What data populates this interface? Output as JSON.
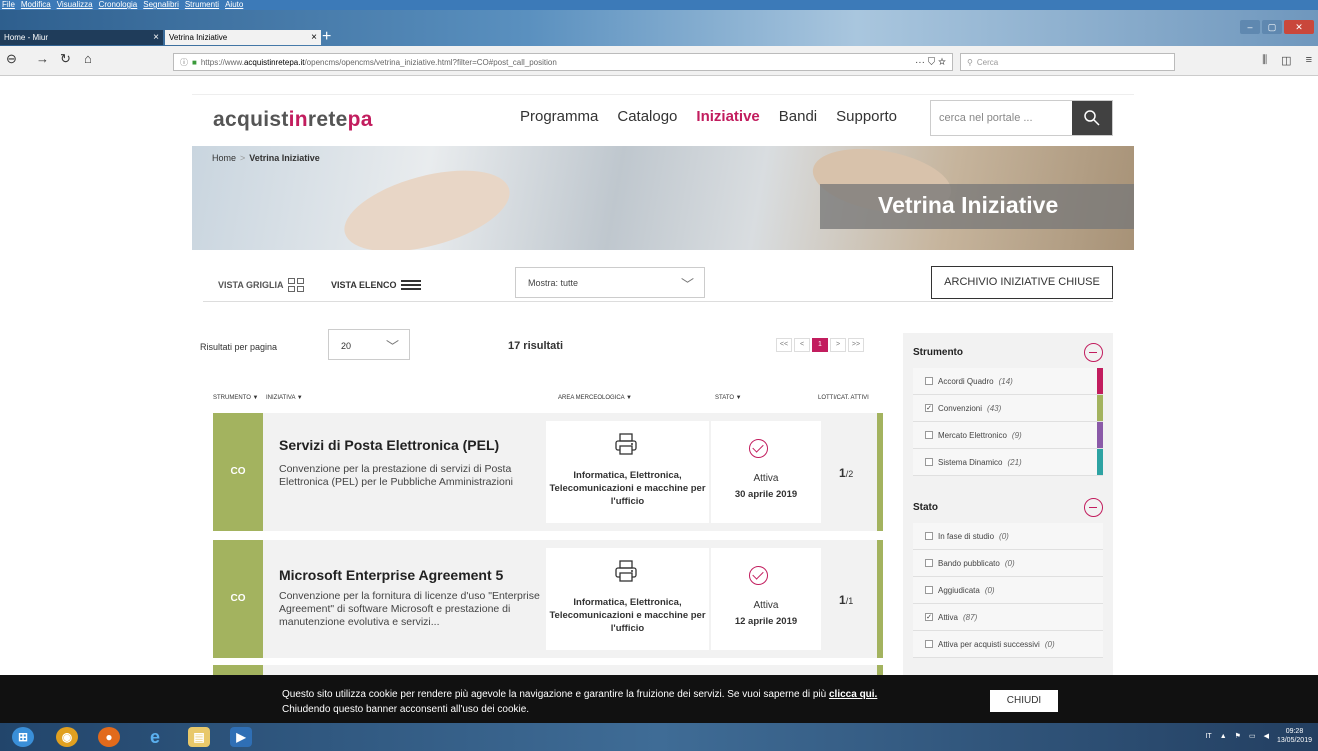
{
  "browser": {
    "menu": [
      "File",
      "Modifica",
      "Visualizza",
      "Cronologia",
      "Segnalibri",
      "Strumenti",
      "Aiuto"
    ],
    "tabs": [
      {
        "label": "Home - Miur"
      },
      {
        "label": "Vetrina Iniziative"
      }
    ],
    "url_prefix": "https://www.",
    "url_host": "acquistinretepa.it",
    "url_path": "/opencms/opencms/vetrina_iniziative.html?filter=CO#post_call_position",
    "url_tools": "··· ⛉ ☆",
    "search_placeholder": "Cerca"
  },
  "site": {
    "logo_pre": "acquist",
    "logo_accent": "in",
    "logo_mid": "rete",
    "logo_accent2": "pa",
    "nav": [
      "Programma",
      "Catalogo",
      "Iniziative",
      "Bandi",
      "Supporto"
    ],
    "search_placeholder": "cerca nel portale ...",
    "breadcrumb": {
      "home": "Home",
      "current": "Vetrina Iniziative"
    },
    "hero_title": "Vetrina Iniziative"
  },
  "controls": {
    "vista_griglia": "VISTA GRIGLIA",
    "vista_elenco": "VISTA ELENCO",
    "mostra": "Mostra: tutte",
    "archive": "ARCHIVIO INIZIATIVE CHIUSE",
    "rpp_label": "Risultati per pagina",
    "rpp_value": "20",
    "results": "17 risultati",
    "pager": [
      "<<",
      "<",
      "1",
      ">",
      ">>"
    ]
  },
  "table_headers": {
    "strumento": "STRUMENTO ▼",
    "iniziativa": "INIZIATIVA ▼",
    "area": "AREA MERCEOLOGICA ▼",
    "stato": "STATO ▼",
    "lotti": "LOTTI/CAT. ATTIVI"
  },
  "cards": [
    {
      "code": "CO",
      "title": "Servizi di Posta Elettronica (PEL)",
      "desc": "Convenzione per la prestazione di servizi di Posta Elettronica (PEL) per le Pubbliche Amministrazioni",
      "area": "Informatica, Elettronica, Telecomunicazioni e macchine per l'ufficio",
      "stato": "Attiva",
      "data": "30 aprile 2019",
      "lotti_num": "1",
      "lotti_den": "/2"
    },
    {
      "code": "CO",
      "title": "Microsoft Enterprise Agreement 5",
      "desc": "Convenzione per la fornitura di licenze d'uso \"Enterprise Agreement\" di software Microsoft e prestazione di manutenzione evolutiva e servizi...",
      "area": "Informatica, Elettronica, Telecomunicazioni e macchine per l'ufficio",
      "stato": "Attiva",
      "data": "12 aprile 2019",
      "lotti_num": "1",
      "lotti_den": "/1"
    }
  ],
  "facets": {
    "strumento_title": "Strumento",
    "strumento": [
      {
        "label": "Accordi Quadro",
        "count": "(14)",
        "checked": "",
        "color": "#c21d5e"
      },
      {
        "label": "Convenzioni",
        "count": "(43)",
        "checked": "✓",
        "color": "#a3b35f"
      },
      {
        "label": "Mercato Elettronico",
        "count": "(9)",
        "checked": "",
        "color": "#8a5aa8"
      },
      {
        "label": "Sistema Dinamico",
        "count": "(21)",
        "checked": "",
        "color": "#2ea3a3"
      }
    ],
    "stato_title": "Stato",
    "stato": [
      {
        "label": "In fase di studio",
        "count": "(0)",
        "checked": ""
      },
      {
        "label": "Bando pubblicato",
        "count": "(0)",
        "checked": ""
      },
      {
        "label": "Aggiudicata",
        "count": "(0)",
        "checked": ""
      },
      {
        "label": "Attiva",
        "count": "(87)",
        "checked": "✓"
      },
      {
        "label": "Attiva per acquisti successivi",
        "count": "(0)",
        "checked": ""
      }
    ]
  },
  "cookie": {
    "text1": "Questo sito utilizza cookie per rendere più agevole la navigazione e garantire la fruizione dei servizi. Se vuoi saperne di più ",
    "link": "clicca qui.",
    "text2": "Chiudendo questo banner acconsenti all'uso dei cookie.",
    "button": "CHIUDI"
  },
  "taskbar": {
    "lang": "IT",
    "time": "09:28",
    "date": "13/05/2019"
  },
  "colors": {
    "accent": "#c21d5e",
    "convenzioni": "#a3b35f"
  }
}
